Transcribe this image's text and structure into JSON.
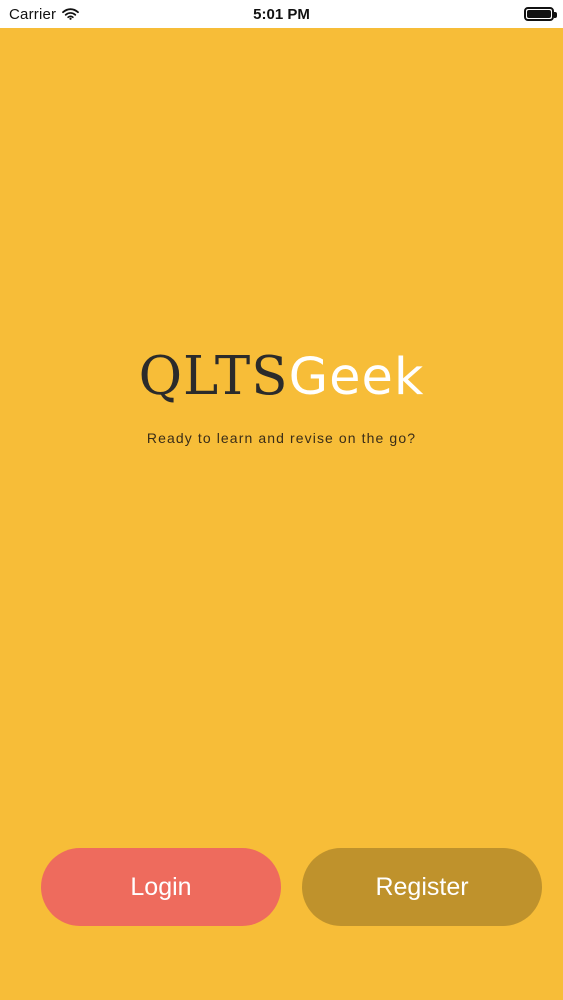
{
  "status_bar": {
    "carrier": "Carrier",
    "time": "5:01 PM"
  },
  "brand": {
    "part_1": "QLTS",
    "part_2": "Geek"
  },
  "tagline": "Ready to learn and revise on the go?",
  "buttons": {
    "login": "Login",
    "register": "Register"
  },
  "colors": {
    "background": "#f7bd38",
    "login_button": "#ee6b5d",
    "register_button": "#bf922c",
    "brand_dark": "#2b2b2b",
    "brand_light": "#ffffff"
  },
  "icons": {
    "wifi": "wifi-icon",
    "battery": "battery-icon"
  }
}
